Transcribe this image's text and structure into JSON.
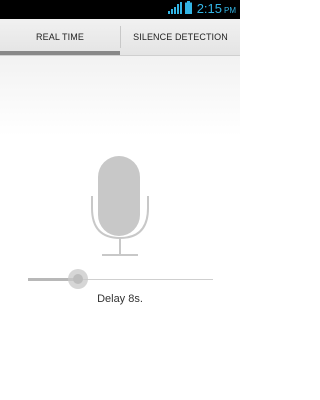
{
  "status_bar": {
    "time": "2:15",
    "ampm": "PM",
    "accent_color": "#33b5e5",
    "icons": [
      "signal-icon",
      "battery-icon"
    ]
  },
  "tabs": [
    {
      "label": "REAL TIME",
      "selected": true
    },
    {
      "label": "SILENCE DETECTION",
      "selected": false
    }
  ],
  "main": {
    "icon": "microphone-icon",
    "delay_slider": {
      "fraction": 0.27
    },
    "delay_label": "Delay 8s."
  }
}
